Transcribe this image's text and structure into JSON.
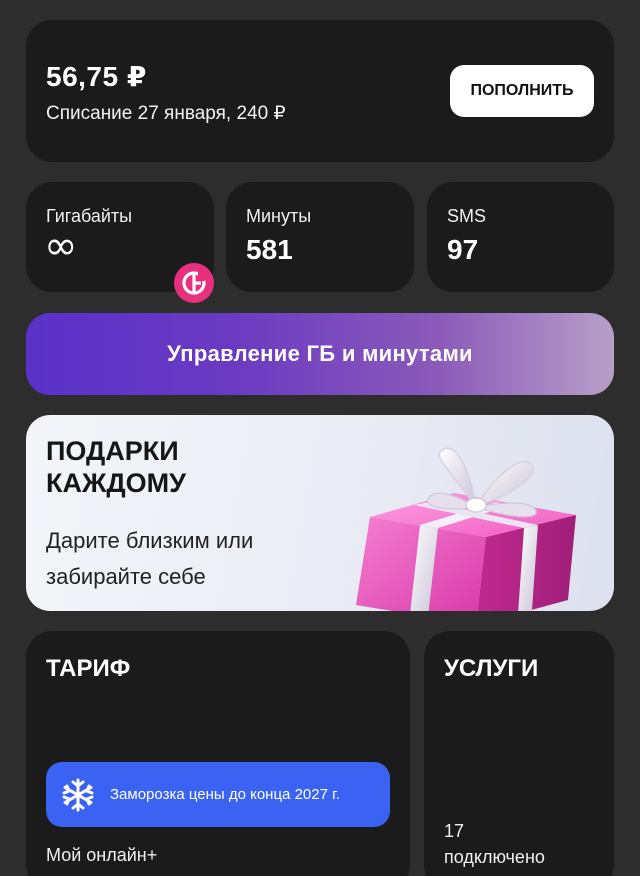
{
  "balance": {
    "amount": "56,75 ₽",
    "next_charge": "Списание 27 января, 240 ₽",
    "topup_label": "пополнить"
  },
  "stats": {
    "gigabytes": {
      "label": "Гигабайты",
      "value": "∞"
    },
    "minutes": {
      "label": "Минуты",
      "value": "581"
    },
    "sms": {
      "label": "SMS",
      "value": "97"
    },
    "badge_icon": "g-coin-icon"
  },
  "manage": {
    "label": "Управление ГБ и минутами"
  },
  "gift_banner": {
    "title": "ПОДАРКИ КАЖДОМУ",
    "subtitle": "Дарите близким или забирайте себе",
    "image_icon": "gift-box-icon"
  },
  "tariff": {
    "heading": "ТАРИФ",
    "freeze_text": "Заморозка цены до конца 2027 г.",
    "freeze_icon": "snowflake-icon",
    "name": "Мой онлайн+"
  },
  "services": {
    "heading": "УСЛУГИ",
    "count": "17",
    "count_label": "подключено"
  },
  "colors": {
    "background": "#2d2d2d",
    "card": "#1b1b1b",
    "accent_blue": "#3a62f3",
    "accent_pink": "#e8307e",
    "manage_gradient_start": "#5a31c9",
    "manage_gradient_end": "#b79fc8"
  }
}
